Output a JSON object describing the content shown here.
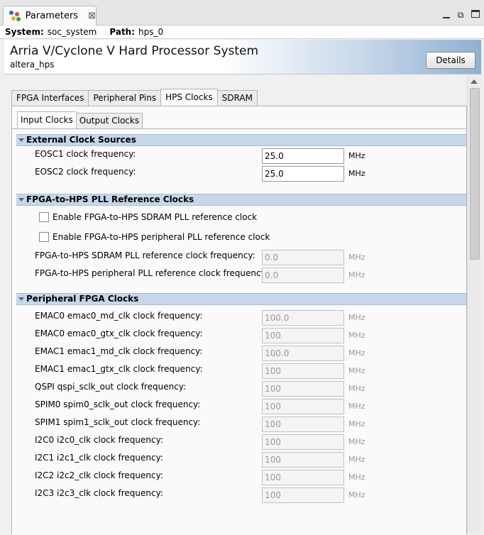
{
  "window": {
    "tab_title": "Parameters",
    "close_glyph": "⊠",
    "controls": {
      "minimize": "_",
      "maximize": "⧉",
      "restore": "▭"
    }
  },
  "path_bar": {
    "system_label": "System:",
    "system_value": "soc_system",
    "path_label": "Path:",
    "path_value": "hps_0"
  },
  "header": {
    "title": "Arria V/Cyclone V Hard Processor System",
    "subtitle": "altera_hps",
    "details_button": "Details"
  },
  "tabs": [
    {
      "label": "FPGA Interfaces",
      "active": false
    },
    {
      "label": "Peripheral Pins",
      "active": false
    },
    {
      "label": "HPS Clocks",
      "active": true
    },
    {
      "label": "SDRAM",
      "active": false
    }
  ],
  "subtabs": [
    {
      "label": "Input Clocks",
      "active": true
    },
    {
      "label": "Output Clocks",
      "active": false
    }
  ],
  "sections": {
    "external": {
      "title": "External Clock Sources",
      "rows": [
        {
          "label": "EOSC1 clock frequency:",
          "value": "25.0",
          "unit": "MHz"
        },
        {
          "label": "EOSC2 clock frequency:",
          "value": "25.0",
          "unit": "MHz"
        }
      ]
    },
    "pll": {
      "title": "FPGA-to-HPS PLL Reference Clocks",
      "checkboxes": [
        {
          "label": "Enable FPGA-to-HPS SDRAM PLL reference clock",
          "checked": false
        },
        {
          "label": "Enable FPGA-to-HPS peripheral PLL reference clock",
          "checked": false
        }
      ],
      "rows": [
        {
          "label": "FPGA-to-HPS SDRAM PLL reference clock frequency:",
          "value": "0.0",
          "unit": "MHz"
        },
        {
          "label": "FPGA-to-HPS peripheral PLL reference clock frequency:",
          "value": "0.0",
          "unit": "MHz"
        }
      ]
    },
    "peripheral": {
      "title": "Peripheral FPGA Clocks",
      "rows": [
        {
          "label": "EMAC0 emac0_md_clk clock frequency:",
          "value": "100.0",
          "unit": "MHz"
        },
        {
          "label": "EMAC0 emac0_gtx_clk clock frequency:",
          "value": "100",
          "unit": "MHz"
        },
        {
          "label": "EMAC1 emac1_md_clk clock frequency:",
          "value": "100.0",
          "unit": "MHz"
        },
        {
          "label": "EMAC1 emac1_gtx_clk clock frequency:",
          "value": "100",
          "unit": "MHz"
        },
        {
          "label": "QSPI qspi_sclk_out clock frequency:",
          "value": "100",
          "unit": "MHz"
        },
        {
          "label": "SPIM0 spim0_sclk_out clock frequency:",
          "value": "100",
          "unit": "MHz"
        },
        {
          "label": "SPIM1 spim1_sclk_out clock frequency:",
          "value": "100",
          "unit": "MHz"
        },
        {
          "label": "I2C0 i2c0_clk clock frequency:",
          "value": "100",
          "unit": "MHz"
        },
        {
          "label": "I2C1 i2c1_clk clock frequency:",
          "value": "100",
          "unit": "MHz"
        },
        {
          "label": "I2C2 i2c2_clk clock frequency:",
          "value": "100",
          "unit": "MHz"
        },
        {
          "label": "I2C3 i2c3_clk clock frequency:",
          "value": "100",
          "unit": "MHz"
        }
      ]
    }
  },
  "colors": {
    "section_header": "#c6d7e9",
    "header_gradient_end": "#8fb0d2"
  }
}
